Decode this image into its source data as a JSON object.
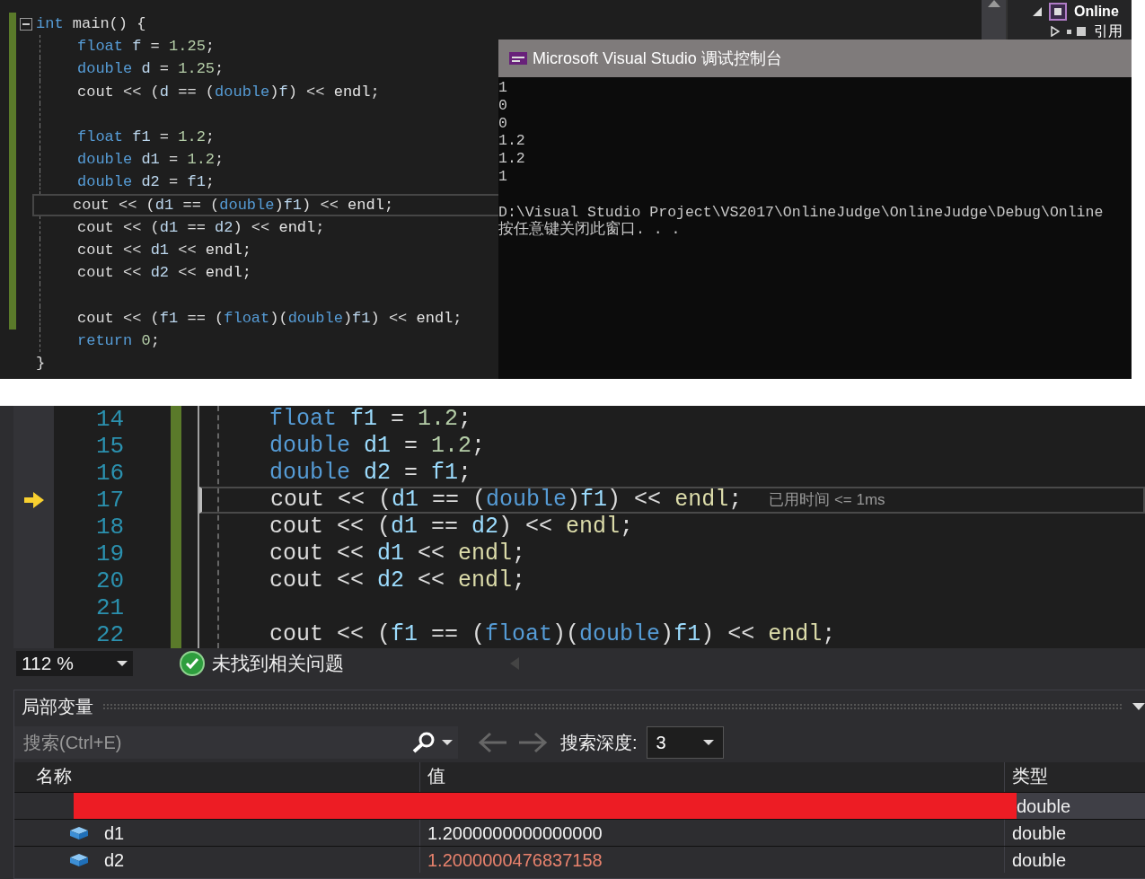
{
  "code_editor": {
    "lines": [
      {
        "kind": "code",
        "modified": true,
        "fold": true,
        "current": false,
        "indented": false,
        "tokens": [
          {
            "kind": "keyword",
            "text": "int"
          },
          {
            "kind": "plain",
            "text": " main() {"
          }
        ]
      },
      {
        "kind": "code",
        "modified": true,
        "fold": false,
        "current": false,
        "indented": true,
        "tokens": [
          {
            "kind": "keyword",
            "text": "float "
          },
          {
            "kind": "variable",
            "text": "f"
          },
          {
            "kind": "plain",
            "text": " = "
          },
          {
            "kind": "number",
            "text": "1.25"
          },
          {
            "kind": "plain",
            "text": ";"
          }
        ]
      },
      {
        "kind": "code",
        "modified": true,
        "fold": false,
        "current": false,
        "indented": true,
        "tokens": [
          {
            "kind": "keyword",
            "text": "double "
          },
          {
            "kind": "variable",
            "text": "d"
          },
          {
            "kind": "plain",
            "text": " = "
          },
          {
            "kind": "number",
            "text": "1.25"
          },
          {
            "kind": "plain",
            "text": ";"
          }
        ]
      },
      {
        "kind": "code",
        "modified": true,
        "fold": false,
        "current": false,
        "indented": true,
        "tokens": [
          {
            "kind": "plain",
            "text": "cout << ("
          },
          {
            "kind": "variable",
            "text": "d"
          },
          {
            "kind": "plain",
            "text": " == ("
          },
          {
            "kind": "keyword",
            "text": "double"
          },
          {
            "kind": "plain",
            "text": ")"
          },
          {
            "kind": "variable",
            "text": "f"
          },
          {
            "kind": "plain",
            "text": ") << "
          },
          {
            "kind": "function",
            "text": "endl"
          },
          {
            "kind": "plain",
            "text": ";"
          }
        ]
      },
      {
        "kind": "blank",
        "modified": true,
        "fold": false,
        "current": false,
        "indented": true
      },
      {
        "kind": "code",
        "modified": true,
        "fold": false,
        "current": false,
        "indented": true,
        "tokens": [
          {
            "kind": "keyword",
            "text": "float "
          },
          {
            "kind": "variable",
            "text": "f1"
          },
          {
            "kind": "plain",
            "text": " = "
          },
          {
            "kind": "number",
            "text": "1.2"
          },
          {
            "kind": "plain",
            "text": ";"
          }
        ]
      },
      {
        "kind": "code",
        "modified": true,
        "fold": false,
        "current": false,
        "indented": true,
        "tokens": [
          {
            "kind": "keyword",
            "text": "double "
          },
          {
            "kind": "variable",
            "text": "d1"
          },
          {
            "kind": "plain",
            "text": " = "
          },
          {
            "kind": "number",
            "text": "1.2"
          },
          {
            "kind": "plain",
            "text": ";"
          }
        ]
      },
      {
        "kind": "code",
        "modified": true,
        "fold": false,
        "current": false,
        "indented": true,
        "tokens": [
          {
            "kind": "keyword",
            "text": "double "
          },
          {
            "kind": "variable",
            "text": "d2"
          },
          {
            "kind": "plain",
            "text": " = "
          },
          {
            "kind": "variable",
            "text": "f1"
          },
          {
            "kind": "plain",
            "text": ";"
          }
        ]
      },
      {
        "kind": "code",
        "modified": true,
        "fold": false,
        "current": true,
        "indented": true,
        "tokens": [
          {
            "kind": "plain",
            "text": "cout << ("
          },
          {
            "kind": "variable",
            "text": "d1"
          },
          {
            "kind": "plain",
            "text": " == ("
          },
          {
            "kind": "keyword",
            "text": "double"
          },
          {
            "kind": "plain",
            "text": ")"
          },
          {
            "kind": "variable",
            "text": "f1"
          },
          {
            "kind": "plain",
            "text": ") << "
          },
          {
            "kind": "function",
            "text": "endl"
          },
          {
            "kind": "plain",
            "text": ";"
          }
        ]
      },
      {
        "kind": "code",
        "modified": true,
        "fold": false,
        "current": false,
        "indented": true,
        "tokens": [
          {
            "kind": "plain",
            "text": "cout << ("
          },
          {
            "kind": "variable",
            "text": "d1"
          },
          {
            "kind": "plain",
            "text": " == "
          },
          {
            "kind": "variable",
            "text": "d2"
          },
          {
            "kind": "plain",
            "text": ") << "
          },
          {
            "kind": "function",
            "text": "endl"
          },
          {
            "kind": "plain",
            "text": ";"
          }
        ]
      },
      {
        "kind": "code",
        "modified": true,
        "fold": false,
        "current": false,
        "indented": true,
        "tokens": [
          {
            "kind": "plain",
            "text": "cout << "
          },
          {
            "kind": "variable",
            "text": "d1"
          },
          {
            "kind": "plain",
            "text": " << "
          },
          {
            "kind": "function",
            "text": "endl"
          },
          {
            "kind": "plain",
            "text": ";"
          }
        ]
      },
      {
        "kind": "code",
        "modified": true,
        "fold": false,
        "current": false,
        "indented": true,
        "tokens": [
          {
            "kind": "plain",
            "text": "cout << "
          },
          {
            "kind": "variable",
            "text": "d2"
          },
          {
            "kind": "plain",
            "text": " << "
          },
          {
            "kind": "function",
            "text": "endl"
          },
          {
            "kind": "plain",
            "text": ";"
          }
        ]
      },
      {
        "kind": "blank",
        "modified": true,
        "fold": false,
        "current": false,
        "indented": true
      },
      {
        "kind": "code",
        "modified": true,
        "fold": false,
        "current": false,
        "indented": true,
        "tokens": [
          {
            "kind": "plain",
            "text": "cout << ("
          },
          {
            "kind": "variable",
            "text": "f1"
          },
          {
            "kind": "plain",
            "text": " == ("
          },
          {
            "kind": "keyword",
            "text": "float"
          },
          {
            "kind": "plain",
            "text": ")("
          },
          {
            "kind": "keyword",
            "text": "double"
          },
          {
            "kind": "plain",
            "text": ")"
          },
          {
            "kind": "variable",
            "text": "f1"
          },
          {
            "kind": "plain",
            "text": ") << "
          },
          {
            "kind": "function",
            "text": "endl"
          },
          {
            "kind": "plain",
            "text": ";"
          }
        ]
      },
      {
        "kind": "code",
        "modified": false,
        "fold": false,
        "current": false,
        "indented": true,
        "tokens": [
          {
            "kind": "keyword",
            "text": "return "
          },
          {
            "kind": "number",
            "text": "0"
          },
          {
            "kind": "plain",
            "text": ";"
          }
        ]
      },
      {
        "kind": "code",
        "modified": false,
        "fold": false,
        "current": false,
        "indented": false,
        "tokens": [
          {
            "kind": "plain",
            "text": "}"
          }
        ]
      }
    ]
  },
  "solution_explorer": {
    "items": [
      {
        "label": "Online",
        "expanded": true,
        "children": [
          {
            "label": "引用",
            "expanded": false
          }
        ]
      }
    ]
  },
  "debug_console": {
    "title": "Microsoft Visual Studio 调试控制台",
    "output": [
      "1",
      "0",
      "0",
      "1.2",
      "1.2",
      "1"
    ],
    "message": [
      "D:\\Visual Studio Project\\VS2017\\OnlineJudge\\OnlineJudge\\Debug\\Online",
      "按任意键关闭此窗口. . ."
    ]
  },
  "debug_editor": {
    "lines": [
      {
        "number": "14",
        "execution_point": false,
        "current": false,
        "kind": "code",
        "tokens": [
          {
            "kind": "keyword",
            "text": "float "
          },
          {
            "kind": "variable",
            "text": "f1"
          },
          {
            "kind": "plain",
            "text": " = "
          },
          {
            "kind": "number",
            "text": "1.2"
          },
          {
            "kind": "plain",
            "text": ";"
          }
        ]
      },
      {
        "number": "15",
        "execution_point": false,
        "current": false,
        "kind": "code",
        "tokens": [
          {
            "kind": "keyword",
            "text": "double "
          },
          {
            "kind": "variable",
            "text": "d1"
          },
          {
            "kind": "plain",
            "text": " = "
          },
          {
            "kind": "number",
            "text": "1.2"
          },
          {
            "kind": "plain",
            "text": ";"
          }
        ]
      },
      {
        "number": "16",
        "execution_point": false,
        "current": false,
        "kind": "code",
        "tokens": [
          {
            "kind": "keyword",
            "text": "double "
          },
          {
            "kind": "variable",
            "text": "d2"
          },
          {
            "kind": "plain",
            "text": " = "
          },
          {
            "kind": "variable",
            "text": "f1"
          },
          {
            "kind": "plain",
            "text": ";"
          }
        ]
      },
      {
        "number": "17",
        "execution_point": true,
        "current": true,
        "kind": "code",
        "perf_tip": "已用时间 <= 1ms",
        "tokens": [
          {
            "kind": "plain",
            "text": "cout << ("
          },
          {
            "kind": "variable",
            "text": "d1"
          },
          {
            "kind": "plain",
            "text": " == ("
          },
          {
            "kind": "keyword",
            "text": "double"
          },
          {
            "kind": "plain",
            "text": ")"
          },
          {
            "kind": "variable",
            "text": "f1"
          },
          {
            "kind": "plain",
            "text": ") << "
          },
          {
            "kind": "function",
            "text": "endl"
          },
          {
            "kind": "plain",
            "text": ";"
          }
        ]
      },
      {
        "number": "18",
        "execution_point": false,
        "current": false,
        "kind": "code",
        "tokens": [
          {
            "kind": "plain",
            "text": "cout << ("
          },
          {
            "kind": "variable",
            "text": "d1"
          },
          {
            "kind": "plain",
            "text": " == "
          },
          {
            "kind": "variable",
            "text": "d2"
          },
          {
            "kind": "plain",
            "text": ") << "
          },
          {
            "kind": "function",
            "text": "endl"
          },
          {
            "kind": "plain",
            "text": ";"
          }
        ]
      },
      {
        "number": "19",
        "execution_point": false,
        "current": false,
        "kind": "code",
        "tokens": [
          {
            "kind": "plain",
            "text": "cout << "
          },
          {
            "kind": "variable",
            "text": "d1"
          },
          {
            "kind": "plain",
            "text": " << "
          },
          {
            "kind": "function",
            "text": "endl"
          },
          {
            "kind": "plain",
            "text": ";"
          }
        ]
      },
      {
        "number": "20",
        "execution_point": false,
        "current": false,
        "kind": "code",
        "tokens": [
          {
            "kind": "plain",
            "text": "cout << "
          },
          {
            "kind": "variable",
            "text": "d2"
          },
          {
            "kind": "plain",
            "text": " << "
          },
          {
            "kind": "function",
            "text": "endl"
          },
          {
            "kind": "plain",
            "text": ";"
          }
        ]
      },
      {
        "number": "21",
        "execution_point": false,
        "current": false,
        "kind": "blank"
      },
      {
        "number": "22",
        "execution_point": false,
        "current": false,
        "kind": "code",
        "tokens": [
          {
            "kind": "plain",
            "text": "cout << ("
          },
          {
            "kind": "variable",
            "text": "f1"
          },
          {
            "kind": "plain",
            "text": " == ("
          },
          {
            "kind": "keyword",
            "text": "float"
          },
          {
            "kind": "plain",
            "text": ")("
          },
          {
            "kind": "keyword",
            "text": "double"
          },
          {
            "kind": "plain",
            "text": ")"
          },
          {
            "kind": "variable",
            "text": "f1"
          },
          {
            "kind": "plain",
            "text": ") << "
          },
          {
            "kind": "function",
            "text": "endl"
          },
          {
            "kind": "plain",
            "text": ";"
          }
        ]
      }
    ]
  },
  "status_bar": {
    "zoom": "112 %",
    "issues": "未找到相关问题"
  },
  "locals": {
    "title": "局部变量",
    "search": {
      "placeholder": "搜索(Ctrl+E)"
    },
    "depth_label": "搜索深度:",
    "depth": "3",
    "columns": [
      "名称",
      "值",
      "类型"
    ],
    "rows": [
      {
        "redacted": true,
        "selected": true,
        "type": "double"
      },
      {
        "redacted": false,
        "selected": false,
        "name": "d1",
        "value": "1.2000000000000000",
        "changed": false,
        "type": "double"
      },
      {
        "redacted": false,
        "selected": false,
        "name": "d2",
        "value": "1.2000000476837158",
        "changed": true,
        "type": "double"
      }
    ]
  }
}
